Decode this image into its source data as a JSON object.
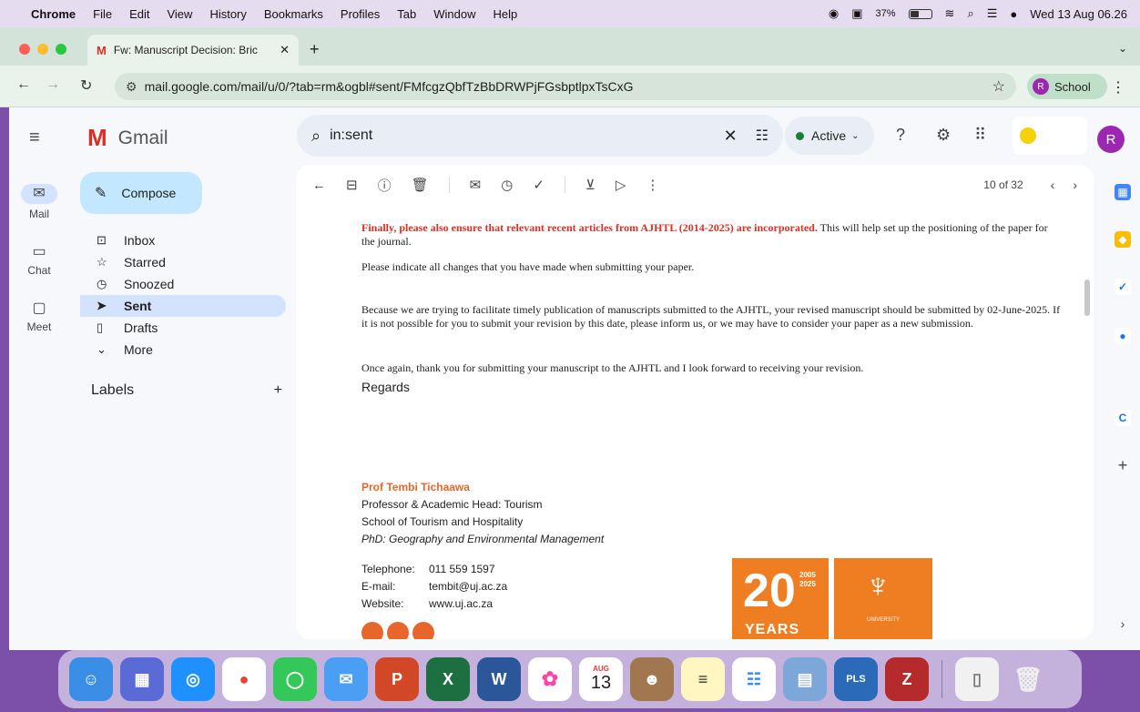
{
  "menubar": {
    "app": "Chrome",
    "items": [
      "File",
      "Edit",
      "View",
      "History",
      "Bookmarks",
      "Profiles",
      "Tab",
      "Window",
      "Help"
    ],
    "battery": "37%",
    "datetime": "Wed 13 Aug 06.26"
  },
  "browser": {
    "tab_title": "Fw: Manuscript Decision: Bric",
    "url": "mail.google.com/mail/u/0/?tab=rm&ogbl#sent/FMfcgzQbfTzBbDRWPjFGsbptlpxTsCxG",
    "profile_initial": "R",
    "profile_label": "School"
  },
  "gmail": {
    "logo_text": "Gmail",
    "search_value": "in:sent",
    "status": "Active",
    "avatar_initial": "R",
    "compose_label": "Compose",
    "rail": [
      {
        "label": "Mail"
      },
      {
        "label": "Chat"
      },
      {
        "label": "Meet"
      }
    ],
    "nav": [
      {
        "label": "Inbox"
      },
      {
        "label": "Starred"
      },
      {
        "label": "Snoozed"
      },
      {
        "label": "Sent"
      },
      {
        "label": "Drafts"
      },
      {
        "label": "More"
      }
    ],
    "labels_heading": "Labels",
    "pager": "10 of 32"
  },
  "email": {
    "para1_red": "Finally, please also ensure that relevant recent articles from AJHTL (2014-2025) are incorporated.",
    "para1_rest": " This will help set up the positioning of the paper for the journal.",
    "para2": "Please indicate all changes that you have made when submitting your paper.",
    "para3": "Because we are trying to facilitate timely publication of manuscripts submitted to the AJHTL, your revised manuscript should be submitted by 02-June-2025.  If it is not possible for you to submit your revision by this date, please inform us, or we may have to consider your paper as a new submission.",
    "para4": "Once again, thank you for submitting your manuscript to the AJHTL and I look forward to receiving your revision.",
    "regards": "Regards",
    "sig_name": "Prof Tembi Tichaawa",
    "sig_title": "Professor & Academic Head: Tourism",
    "sig_school": "School of Tourism and Hospitality",
    "sig_degree": "PhD: Geography and Environmental Management",
    "tel_label": "Telephone:",
    "tel_value": "011 559 1597",
    "email_label": "E-mail:",
    "email_value": "tembit@uj.ac.za",
    "web_label": "Website:",
    "web_value": "www.uj.ac.za",
    "logo_number": "20",
    "logo_years_top": "2005",
    "logo_years_bottom": "2025",
    "logo_years_word": "YEARS",
    "logo_uni": "UNIVERSITY"
  },
  "dock": {
    "calendar_month": "AUG",
    "calendar_day": "13",
    "pls_label": "PLS"
  }
}
